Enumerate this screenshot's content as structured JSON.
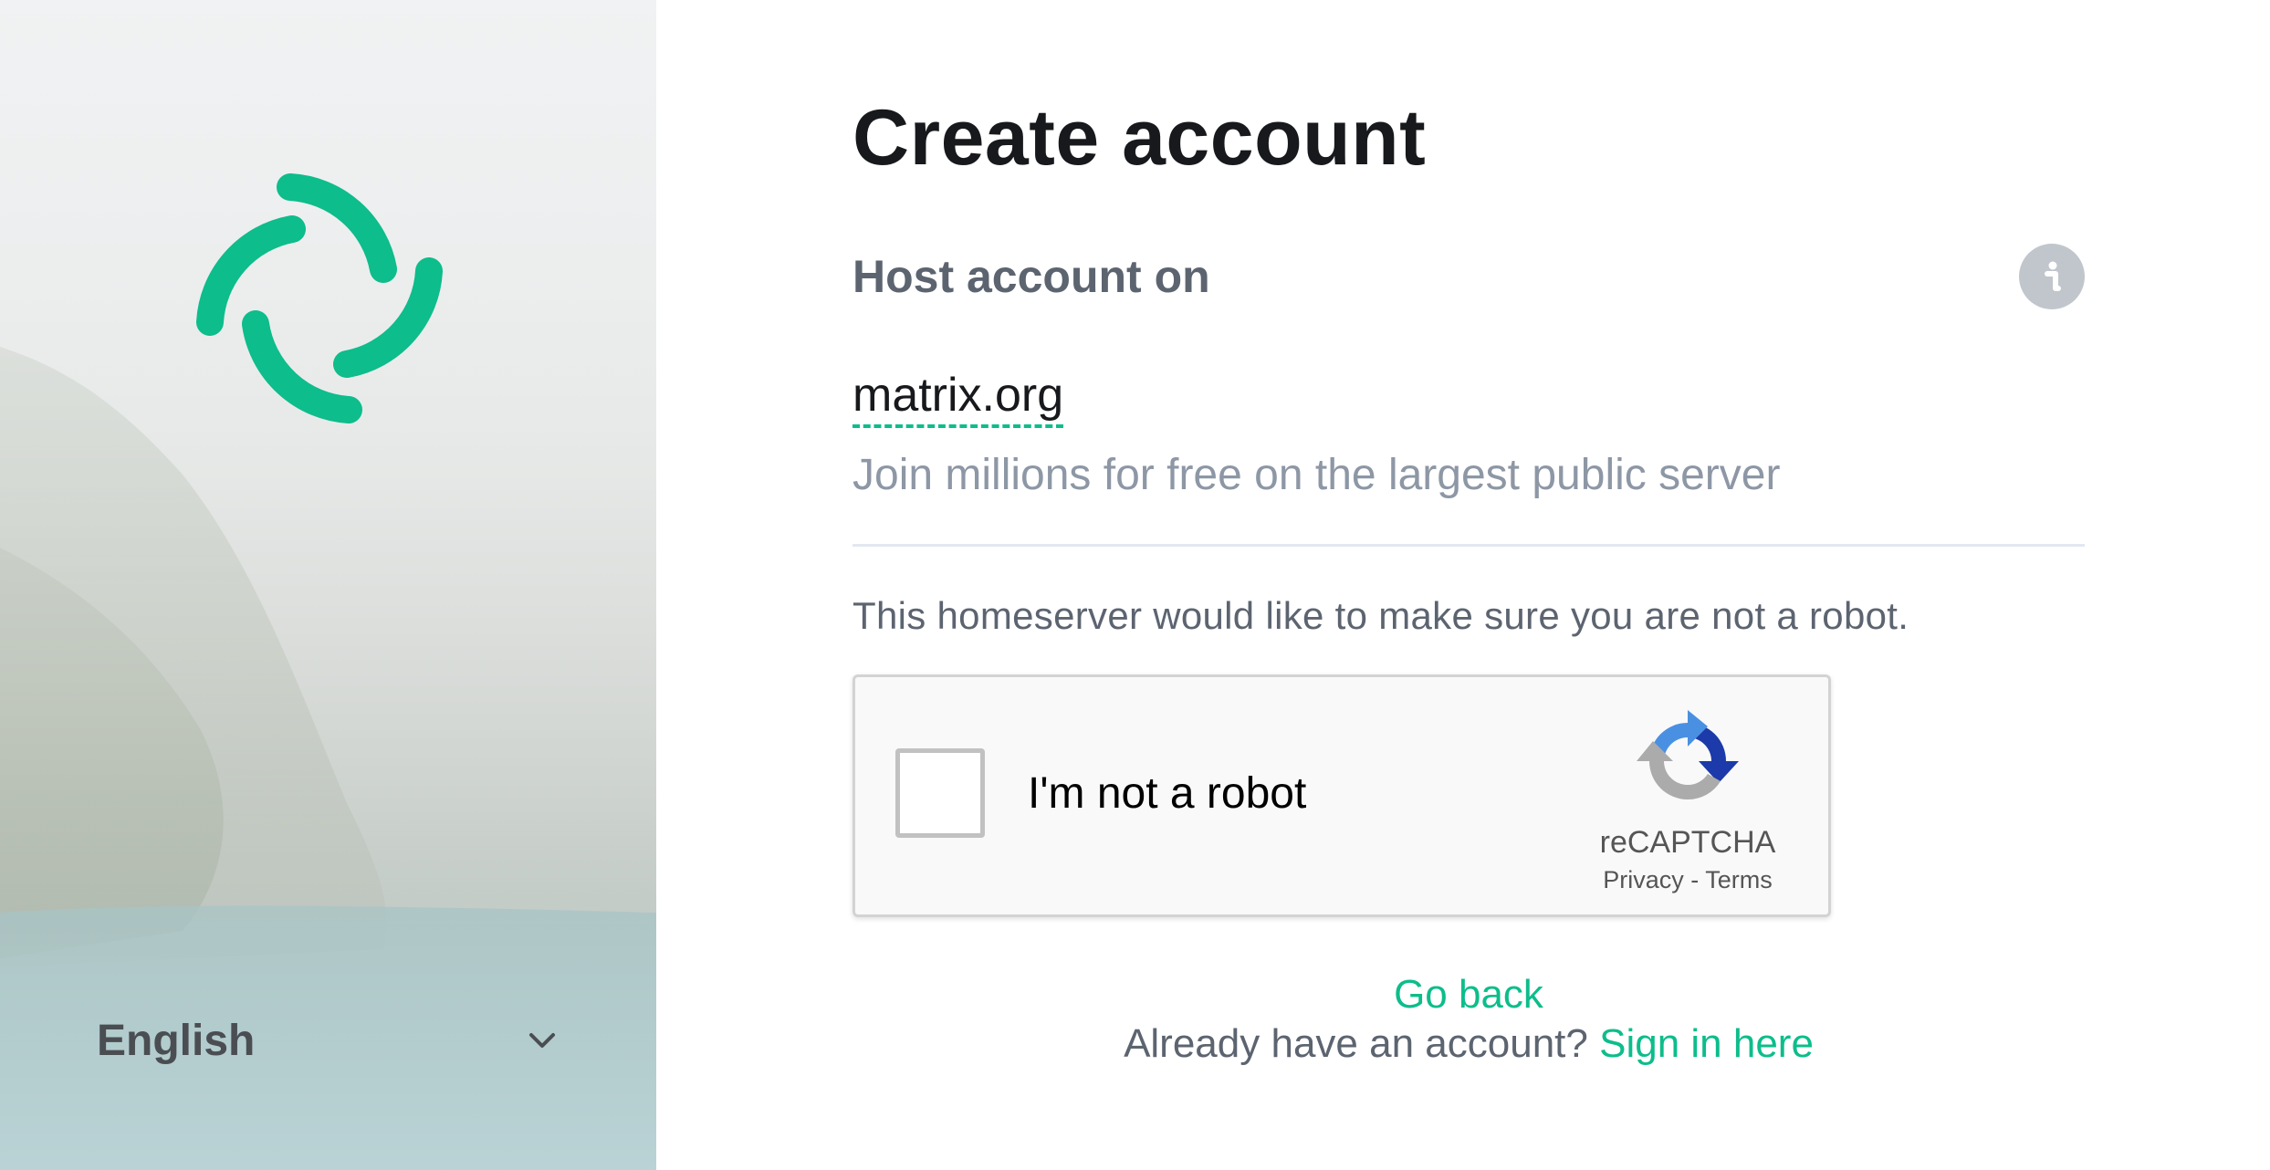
{
  "sidebar": {
    "logo_icon": "element-logo-icon",
    "brand_color": "#0dbd8b",
    "language": {
      "selected": "English",
      "icon": "chevron-down-icon"
    }
  },
  "main": {
    "title": "Create account",
    "host": {
      "label": "Host account on",
      "info_icon": "info-icon",
      "server_name": "matrix.org",
      "server_description": "Join millions for free on the largest public server"
    },
    "robot_check": {
      "message": "This homeserver would like to make sure you are not a robot.",
      "checkbox_label": "I'm not a robot",
      "brand": "reCAPTCHA",
      "privacy_link": "Privacy",
      "separator": " - ",
      "terms_link": "Terms",
      "icon": "recaptcha-icon"
    },
    "footer": {
      "go_back": "Go back",
      "already_text": "Already have an account? ",
      "sign_in_link": "Sign in here"
    }
  },
  "colors": {
    "accent": "#0dbd8b",
    "heading": "#17191c",
    "muted": "#8d97a5",
    "secondary": "#5c6470"
  }
}
